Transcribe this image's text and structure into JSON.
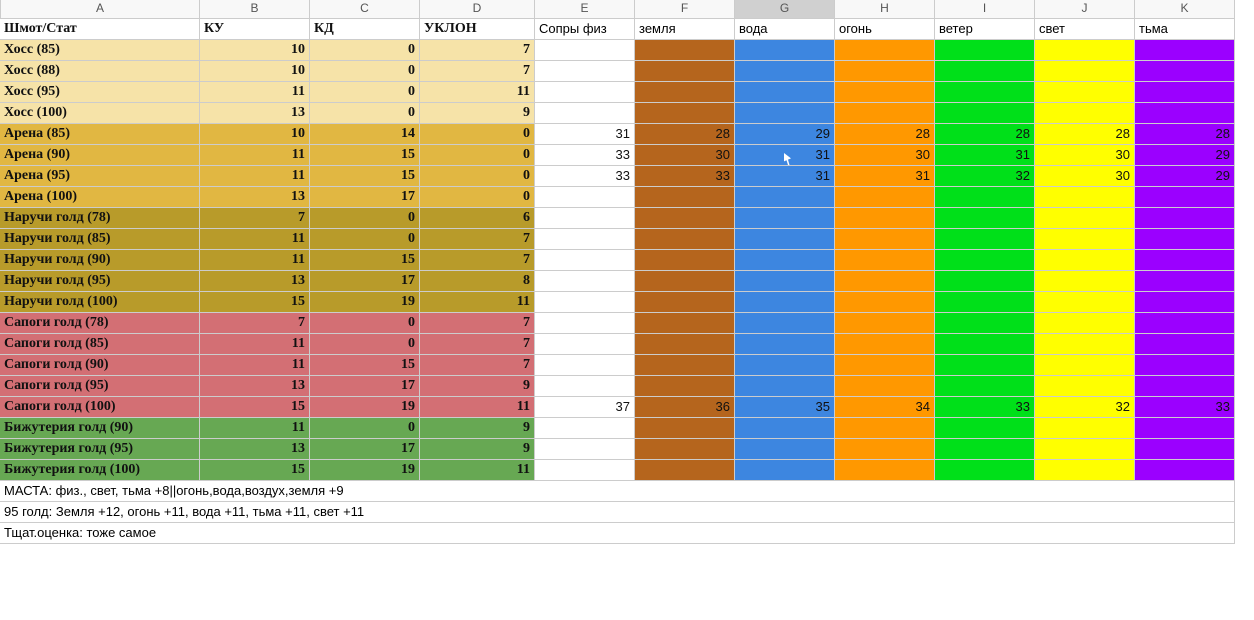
{
  "columns": [
    "A",
    "B",
    "C",
    "D",
    "E",
    "F",
    "G",
    "H",
    "I",
    "J",
    "K"
  ],
  "selectedCol": "G",
  "headers": {
    "A": "Шмот/Стат",
    "B": "КУ",
    "C": "КД",
    "D": "УКЛОН",
    "E": "Сопры физ",
    "F": "земля",
    "G": "вода",
    "H": "огонь",
    "I": "ветер",
    "J": "свет",
    "K": "тьма"
  },
  "elemClasses": {
    "F": "bg-earth",
    "G": "bg-water",
    "H": "bg-fire",
    "I": "bg-wind",
    "J": "bg-light",
    "K": "bg-dark"
  },
  "rows": [
    {
      "theme": "bg-cream",
      "A": "Хосс (85)",
      "B": "10",
      "C": "0",
      "D": "7"
    },
    {
      "theme": "bg-cream",
      "A": "Хосс (88)",
      "B": "10",
      "C": "0",
      "D": "7"
    },
    {
      "theme": "bg-cream",
      "A": "Хосс (95)",
      "B": "11",
      "C": "0",
      "D": "11"
    },
    {
      "theme": "bg-cream",
      "A": "Хосс (100)",
      "B": "13",
      "C": "0",
      "D": "9"
    },
    {
      "theme": "bg-amber",
      "A": "Арена (85)",
      "B": "10",
      "C": "14",
      "D": "0",
      "E": "31",
      "F": "28",
      "G": "29",
      "H": "28",
      "I": "28",
      "J": "28",
      "K": "28"
    },
    {
      "theme": "bg-amber",
      "A": "Арена (90)",
      "B": "11",
      "C": "15",
      "D": "0",
      "E": "33",
      "F": "30",
      "G": "31",
      "H": "30",
      "I": "31",
      "J": "30",
      "K": "29",
      "cursorG": true
    },
    {
      "theme": "bg-amber",
      "A": "Арена (95)",
      "B": "11",
      "C": "15",
      "D": "0",
      "E": "33",
      "F": "33",
      "G": "31",
      "H": "31",
      "I": "32",
      "J": "30",
      "K": "29"
    },
    {
      "theme": "bg-amber",
      "A": "Арена (100)",
      "B": "13",
      "C": "17",
      "D": "0"
    },
    {
      "theme": "bg-olive",
      "A": "Наручи голд (78)",
      "B": "7",
      "C": "0",
      "D": "6"
    },
    {
      "theme": "bg-olive",
      "A": "Наручи голд (85)",
      "B": "11",
      "C": "0",
      "D": "7"
    },
    {
      "theme": "bg-olive",
      "A": "Наручи голд (90)",
      "B": "11",
      "C": "15",
      "D": "7"
    },
    {
      "theme": "bg-olive",
      "A": "Наручи голд (95)",
      "B": "13",
      "C": "17",
      "D": "8"
    },
    {
      "theme": "bg-olive",
      "A": "Наручи голд (100)",
      "B": "15",
      "C": "19",
      "D": "11"
    },
    {
      "theme": "bg-rose",
      "A": "Сапоги голд (78)",
      "B": "7",
      "C": "0",
      "D": "7"
    },
    {
      "theme": "bg-rose",
      "A": "Сапоги голд (85)",
      "B": "11",
      "C": "0",
      "D": "7"
    },
    {
      "theme": "bg-rose",
      "A": "Сапоги голд (90)",
      "B": "11",
      "C": "15",
      "D": "7"
    },
    {
      "theme": "bg-rose",
      "A": "Сапоги голд (95)",
      "B": "13",
      "C": "17",
      "D": "9"
    },
    {
      "theme": "bg-rose",
      "A": "Сапоги голд (100)",
      "B": "15",
      "C": "19",
      "D": "11",
      "E": "37",
      "F": "36",
      "G": "35",
      "H": "34",
      "I": "33",
      "J": "32",
      "K": "33"
    },
    {
      "theme": "bg-green",
      "A": "Бижутерия голд (90)",
      "B": "11",
      "C": "0",
      "D": "9"
    },
    {
      "theme": "bg-green",
      "A": "Бижутерия голд (95)",
      "B": "13",
      "C": "17",
      "D": "9"
    },
    {
      "theme": "bg-green",
      "A": "Бижутерия голд (100)",
      "B": "15",
      "C": "19",
      "D": "11"
    }
  ],
  "footnotes": [
    "МАСТА: физ., свет, тьма +8||огонь,вода,воздух,земля +9",
    "95 голд: Земля +12, огонь +11, вода +11, тьма +11, свет +11",
    "Тщат.оценка: тоже самое"
  ],
  "chart_data": {
    "type": "table",
    "title": "Шмот/Стат",
    "columns": [
      "Шмот/Стат",
      "КУ",
      "КД",
      "УКЛОН",
      "Сопры физ",
      "земля",
      "вода",
      "огонь",
      "ветер",
      "свет",
      "тьма"
    ],
    "rows": [
      [
        "Хосс (85)",
        10,
        0,
        7,
        null,
        null,
        null,
        null,
        null,
        null,
        null
      ],
      [
        "Хосс (88)",
        10,
        0,
        7,
        null,
        null,
        null,
        null,
        null,
        null,
        null
      ],
      [
        "Хосс (95)",
        11,
        0,
        11,
        null,
        null,
        null,
        null,
        null,
        null,
        null
      ],
      [
        "Хосс (100)",
        13,
        0,
        9,
        null,
        null,
        null,
        null,
        null,
        null,
        null
      ],
      [
        "Арена (85)",
        10,
        14,
        0,
        31,
        28,
        29,
        28,
        28,
        28,
        28
      ],
      [
        "Арена (90)",
        11,
        15,
        0,
        33,
        30,
        31,
        30,
        31,
        30,
        29
      ],
      [
        "Арена (95)",
        11,
        15,
        0,
        33,
        33,
        31,
        31,
        32,
        30,
        29
      ],
      [
        "Арена (100)",
        13,
        17,
        0,
        null,
        null,
        null,
        null,
        null,
        null,
        null
      ],
      [
        "Наручи голд (78)",
        7,
        0,
        6,
        null,
        null,
        null,
        null,
        null,
        null,
        null
      ],
      [
        "Наручи голд (85)",
        11,
        0,
        7,
        null,
        null,
        null,
        null,
        null,
        null,
        null
      ],
      [
        "Наручи голд (90)",
        11,
        15,
        7,
        null,
        null,
        null,
        null,
        null,
        null,
        null
      ],
      [
        "Наручи голд (95)",
        13,
        17,
        8,
        null,
        null,
        null,
        null,
        null,
        null,
        null
      ],
      [
        "Наручи голд (100)",
        15,
        19,
        11,
        null,
        null,
        null,
        null,
        null,
        null,
        null
      ],
      [
        "Сапоги голд (78)",
        7,
        0,
        7,
        null,
        null,
        null,
        null,
        null,
        null,
        null
      ],
      [
        "Сапоги голд (85)",
        11,
        0,
        7,
        null,
        null,
        null,
        null,
        null,
        null,
        null
      ],
      [
        "Сапоги голд (90)",
        11,
        15,
        7,
        null,
        null,
        null,
        null,
        null,
        null,
        null
      ],
      [
        "Сапоги голд (95)",
        13,
        17,
        9,
        null,
        null,
        null,
        null,
        null,
        null,
        null
      ],
      [
        "Сапоги голд (100)",
        15,
        19,
        11,
        37,
        36,
        35,
        34,
        33,
        32,
        33
      ],
      [
        "Бижутерия голд (90)",
        11,
        0,
        9,
        null,
        null,
        null,
        null,
        null,
        null,
        null
      ],
      [
        "Бижутерия голд (95)",
        13,
        17,
        9,
        null,
        null,
        null,
        null,
        null,
        null,
        null
      ],
      [
        "Бижутерия голд (100)",
        15,
        19,
        11,
        null,
        null,
        null,
        null,
        null,
        null,
        null
      ]
    ]
  }
}
